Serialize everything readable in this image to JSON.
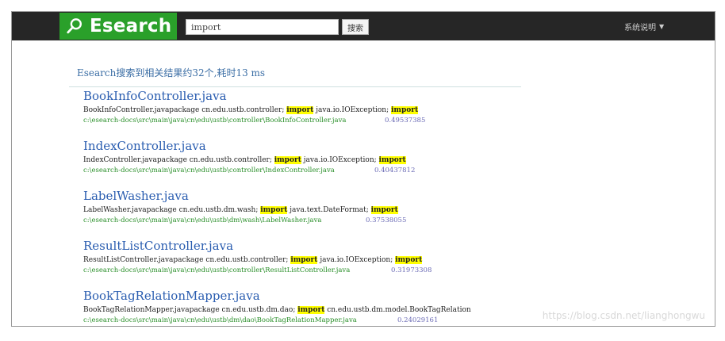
{
  "brand": {
    "name": "Esearch",
    "color": "#2aa02a"
  },
  "search": {
    "value": "import",
    "button_label": "搜索"
  },
  "nav": {
    "system_menu_label": "系统说明"
  },
  "summary": "Esearch搜索到相关结果约32个,耗时13 ms",
  "results": [
    {
      "title": "BookInfoController.java",
      "snippet_before": "BookInfoController.javapackage cn.edu.ustb.controller; ",
      "hl1": "import",
      "snippet_mid": " java.io.IOException; ",
      "hl2": "import",
      "snippet_after": "",
      "path": "c:\\esearch-docs\\src\\main\\java\\cn\\edu\\ustb\\controller\\BookInfoController.java",
      "score": "0.49537385"
    },
    {
      "title": "IndexController.java",
      "snippet_before": "IndexController.javapackage cn.edu.ustb.controller; ",
      "hl1": "import",
      "snippet_mid": " java.io.IOException; ",
      "hl2": "import",
      "snippet_after": "",
      "path": "c:\\esearch-docs\\src\\main\\java\\cn\\edu\\ustb\\controller\\IndexController.java",
      "score": "0.40437812"
    },
    {
      "title": "LabelWasher.java",
      "snippet_before": "LabelWasher.javapackage cn.edu.ustb.dm.wash; ",
      "hl1": "import",
      "snippet_mid": " java.text.DateFormat; ",
      "hl2": "import",
      "snippet_after": "",
      "path": "c:\\esearch-docs\\src\\main\\java\\cn\\edu\\ustb\\dm\\wash\\LabelWasher.java",
      "score": "0.37538055"
    },
    {
      "title": "ResultListController.java",
      "snippet_before": "ResultListController.javapackage cn.edu.ustb.controller; ",
      "hl1": "import",
      "snippet_mid": " java.io.IOException; ",
      "hl2": "import",
      "snippet_after": "",
      "path": "c:\\esearch-docs\\src\\main\\java\\cn\\edu\\ustb\\controller\\ResultListController.java",
      "score": "0.31973308"
    },
    {
      "title": "BookTagRelationMapper.java",
      "snippet_before": "BookTagRelationMapper.javapackage cn.edu.ustb.dm.dao; ",
      "hl1": "import",
      "snippet_mid": " cn.edu.ustb.dm.model.BookTagRelation",
      "hl2": "",
      "snippet_after": "",
      "path": "c:\\esearch-docs\\src\\main\\java\\cn\\edu\\ustb\\dm\\dao\\BookTagRelationMapper.java",
      "score": "0.24029161"
    }
  ],
  "watermark": "https://blog.csdn.net/lianghongwu"
}
